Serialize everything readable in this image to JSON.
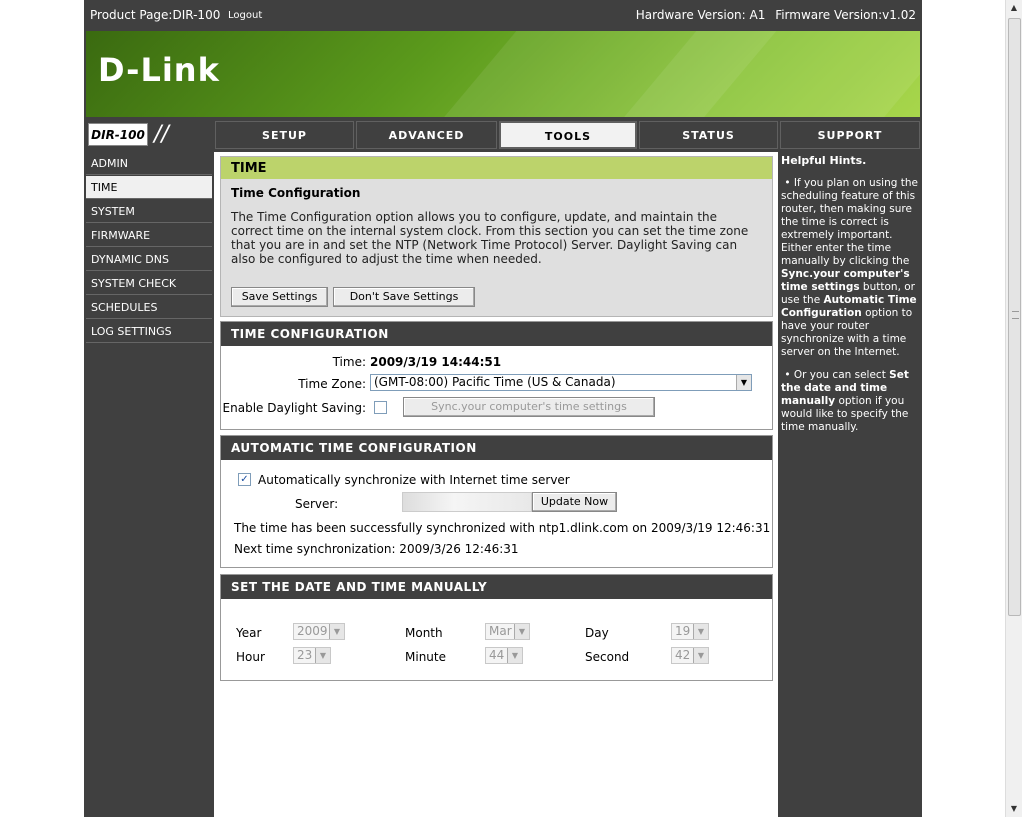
{
  "topbar": {
    "product": "Product Page:DIR-100",
    "logout": "Logout",
    "hardware": "Hardware Version: A1",
    "firmware": "Firmware Version:v1.02"
  },
  "brand": {
    "logo": "D-Link",
    "model": "DIR-100"
  },
  "tabs": [
    {
      "label": "SETUP"
    },
    {
      "label": "ADVANCED"
    },
    {
      "label": "TOOLS"
    },
    {
      "label": "STATUS"
    },
    {
      "label": "SUPPORT"
    }
  ],
  "active_tab": "TOOLS",
  "sidebar": {
    "items": [
      {
        "label": "ADMIN"
      },
      {
        "label": "TIME"
      },
      {
        "label": "SYSTEM"
      },
      {
        "label": "FIRMWARE"
      },
      {
        "label": "DYNAMIC DNS"
      },
      {
        "label": "SYSTEM CHECK"
      },
      {
        "label": "SCHEDULES"
      },
      {
        "label": "LOG SETTINGS"
      }
    ],
    "active": "TIME"
  },
  "intro": {
    "header": "TIME",
    "subtitle": "Time Configuration",
    "description": "The Time Configuration option allows you to configure, update, and maintain the correct time on the internal system clock. From this section you can set the time zone that you are in and set the NTP (Network Time Protocol) Server. Daylight Saving can also be configured to adjust the time when needed.",
    "save_label": "Save Settings",
    "dont_save_label": "Don't Save Settings"
  },
  "time_config": {
    "header": "TIME CONFIGURATION",
    "time_label": "Time:",
    "time_value": "2009/3/19 14:44:51",
    "zone_label": "Time Zone:",
    "zone_value": "(GMT-08:00) Pacific Time (US & Canada)",
    "dst_label": "Enable Daylight Saving:",
    "dst_checked": false,
    "sync_label": "Sync.your computer's time settings"
  },
  "auto_time": {
    "header": "AUTOMATIC TIME CONFIGURATION",
    "auto_label": "Automatically synchronize with Internet time server",
    "auto_checked": true,
    "server_label": "Server:",
    "update_label": "Update Now",
    "status": "The time has been successfully synchronized with ntp1.dlink.com on 2009/3/19 12:46:31",
    "next": "Next time synchronization: 2009/3/26 12:46:31"
  },
  "manual": {
    "header": "SET THE DATE AND TIME MANUALLY",
    "year_label": "Year",
    "year": "2009",
    "month_label": "Month",
    "month": "Mar",
    "day_label": "Day",
    "day": "19",
    "hour_label": "Hour",
    "hour": "23",
    "minute_label": "Minute",
    "minute": "44",
    "second_label": "Second",
    "second": "42"
  },
  "hints": {
    "title": "Helpful Hints.",
    "p1_a": "If you plan on using the scheduling feature of this router, then making sure the time is correct is extremely important. Either enter the time manually by clicking the ",
    "p1_b": "Sync.your computer's time settings",
    "p1_c": " button, or use the ",
    "p1_d": "Automatic Time Configuration",
    "p1_e": " option to have your router synchronize with a time server on the Internet.",
    "p2_a": "Or you can select ",
    "p2_b": "Set the date and time manually",
    "p2_c": " option if you would like to specify the time manually."
  },
  "colors": {
    "dark": "#404040",
    "banner_green": "#5b9a1c",
    "intro_header": "#bcd36b"
  }
}
